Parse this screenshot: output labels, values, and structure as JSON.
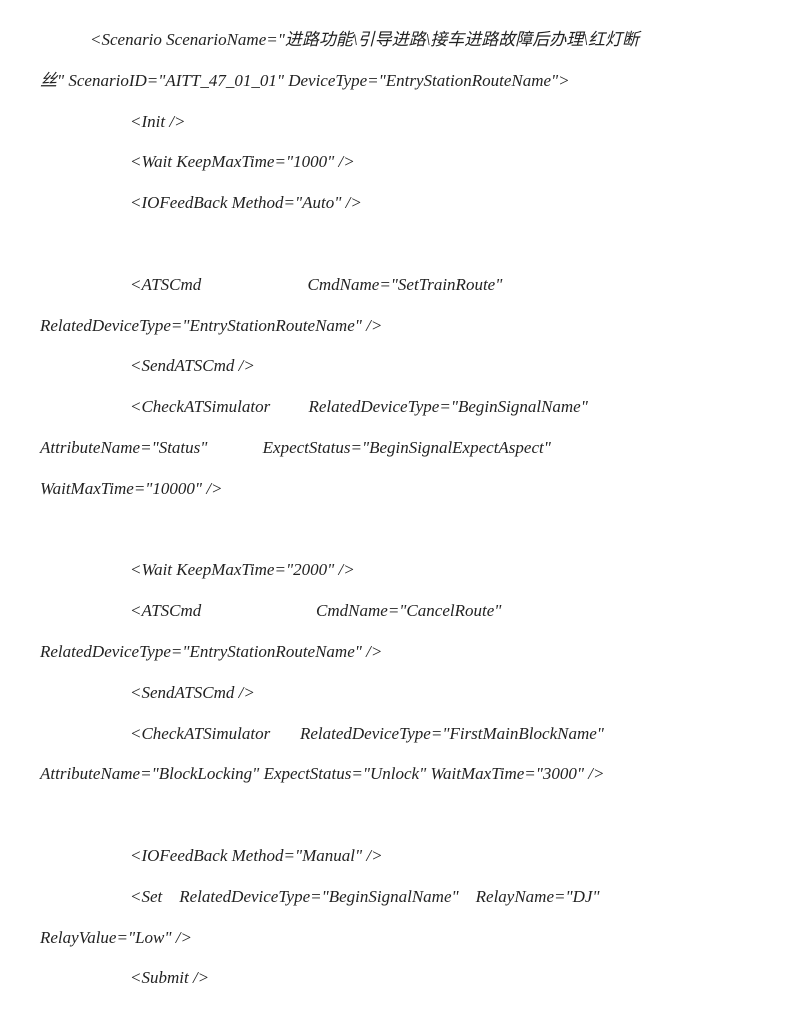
{
  "lines": [
    {
      "cls": "indent1",
      "text": "<Scenario ScenarioName=\"进路功能\\引导进路\\接车进路故障后办理\\红灯断"
    },
    {
      "cls": "cont",
      "text": "丝\" ScenarioID=\"AITT_47_01_01\" DeviceType=\"EntryStationRouteName\">"
    },
    {
      "cls": "indent2",
      "text": "<Init />"
    },
    {
      "cls": "indent2",
      "text": "<Wait KeepMaxTime=\"1000\" />"
    },
    {
      "cls": "indent2",
      "text": "<IOFeedBack Method=\"Auto\" />"
    },
    {
      "cls": "indent2",
      "text": " "
    },
    {
      "cls": "indent2",
      "text": "<ATSCmd                         CmdName=\"SetTrainRoute\""
    },
    {
      "cls": "cont",
      "text": "RelatedDeviceType=\"EntryStationRouteName\" />"
    },
    {
      "cls": "indent2",
      "text": "<SendATSCmd />"
    },
    {
      "cls": "indent2",
      "text": "<CheckATSimulator         RelatedDeviceType=\"BeginSignalName\""
    },
    {
      "cls": "cont",
      "text": "AttributeName=\"Status\"             ExpectStatus=\"BeginSignalExpectAspect\""
    },
    {
      "cls": "cont",
      "text": "WaitMaxTime=\"10000\" />"
    },
    {
      "cls": "indent2",
      "text": " "
    },
    {
      "cls": "indent2",
      "text": "<Wait KeepMaxTime=\"2000\" />"
    },
    {
      "cls": "indent2",
      "text": "<ATSCmd                           CmdName=\"CancelRoute\""
    },
    {
      "cls": "cont",
      "text": "RelatedDeviceType=\"EntryStationRouteName\" />"
    },
    {
      "cls": "indent2",
      "text": "<SendATSCmd />"
    },
    {
      "cls": "indent2",
      "text": "<CheckATSimulator       RelatedDeviceType=\"FirstMainBlockName\""
    },
    {
      "cls": "cont",
      "text": "AttributeName=\"BlockLocking\" ExpectStatus=\"Unlock\" WaitMaxTime=\"3000\" />"
    },
    {
      "cls": "indent2",
      "text": " "
    },
    {
      "cls": "indent2",
      "text": "<IOFeedBack Method=\"Manual\" />"
    },
    {
      "cls": "indent2",
      "text": "<Set    RelatedDeviceType=\"BeginSignalName\"    RelayName=\"DJ\""
    },
    {
      "cls": "cont",
      "text": "RelayValue=\"Low\" />"
    },
    {
      "cls": "indent2",
      "text": "<Submit />"
    }
  ]
}
